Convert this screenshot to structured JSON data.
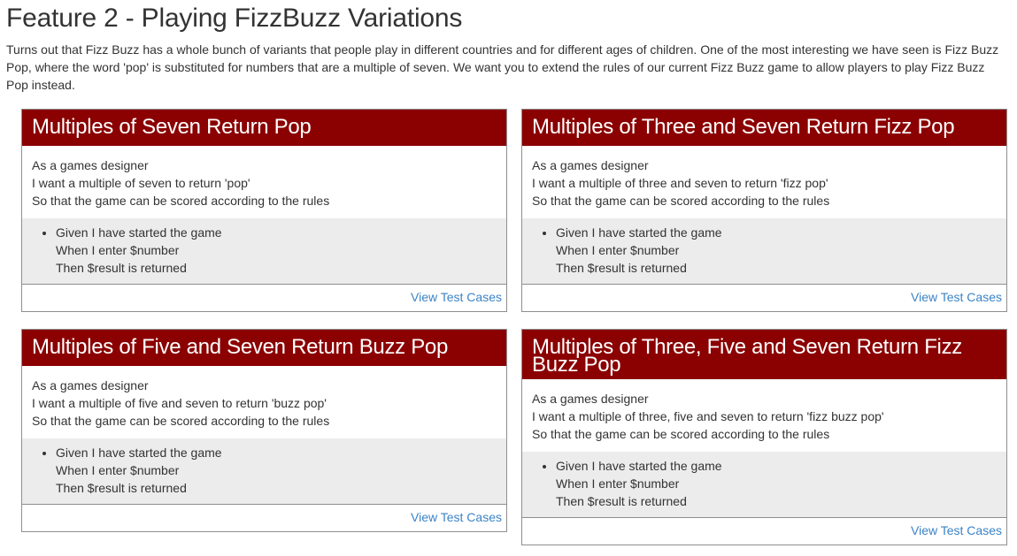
{
  "page": {
    "title": "Feature 2 - Playing FizzBuzz Variations",
    "intro": "Turns out that Fizz Buzz has a whole bunch of variants that people play in different countries and for different ages of children. One of the most interesting we have seen is Fizz Buzz Pop, where the word 'pop' is substituted for numbers that are a multiple of seven. We want you to extend the rules of our current Fizz Buzz game to allow players to play Fizz Buzz Pop instead."
  },
  "cards": [
    {
      "title": "Multiples of Seven Return Pop",
      "story": [
        "As a games designer",
        "I want a multiple of seven to return 'pop'",
        "So that the game can be scored according to the rules"
      ],
      "scenario": [
        "Given I have started the game",
        "When I enter $number",
        "Then $result is returned"
      ],
      "link": "View Test Cases"
    },
    {
      "title": "Multiples of Three and Seven Return Fizz Pop",
      "story": [
        "As a games designer",
        "I want a multiple of three and seven to return 'fizz pop'",
        "So that the game can be scored according to the rules"
      ],
      "scenario": [
        "Given I have started the game",
        "When I enter $number",
        "Then $result is returned"
      ],
      "link": "View Test Cases"
    },
    {
      "title": "Multiples of Five and Seven Return Buzz Pop",
      "story": [
        "As a games designer",
        "I want a multiple of five and seven to return 'buzz pop'",
        "So that the game can be scored according to the rules"
      ],
      "scenario": [
        "Given I have started the game",
        "When I enter $number",
        "Then $result is returned"
      ],
      "link": "View Test Cases"
    },
    {
      "title": "Multiples of Three, Five and Seven Return Fizz Buzz Pop",
      "story": [
        "As a games designer",
        "I want a multiple of three, five and seven to return 'fizz buzz pop'",
        "So that the game can be scored according to the rules"
      ],
      "scenario": [
        "Given I have started the game",
        "When I enter $number",
        "Then $result is returned"
      ],
      "link": "View Test Cases"
    }
  ],
  "colors": {
    "header_bg": "#8b0000",
    "scenario_bg": "#ececec",
    "link": "#3b83c6"
  }
}
